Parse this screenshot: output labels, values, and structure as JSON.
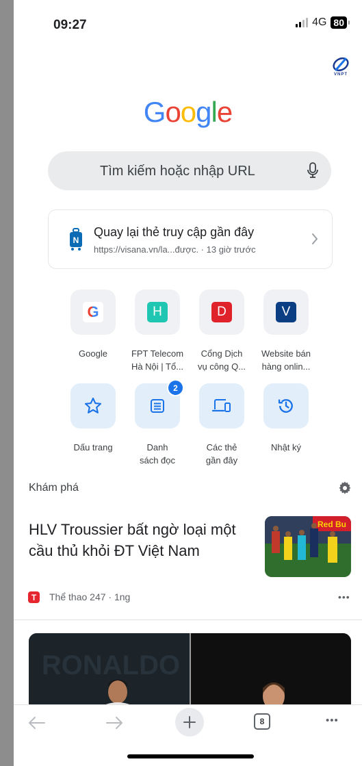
{
  "status_bar": {
    "time": "09:27",
    "network": "4G",
    "battery": "80"
  },
  "brand": {
    "operator_logo_text": "VNPT"
  },
  "logo": {
    "letters": [
      {
        "char": "G",
        "color": "#4285F4"
      },
      {
        "char": "o",
        "color": "#EA4335"
      },
      {
        "char": "o",
        "color": "#FBBC05"
      },
      {
        "char": "g",
        "color": "#4285F4"
      },
      {
        "char": "l",
        "color": "#34A853"
      },
      {
        "char": "e",
        "color": "#EA4335"
      }
    ]
  },
  "search": {
    "placeholder": "Tìm kiếm hoặc nhập URL"
  },
  "recent_tab": {
    "title": "Quay lại thẻ truy cập gần đây",
    "subtitle": "https://visana.vn/la...được. · 13 giờ trước"
  },
  "shortcuts": [
    {
      "letter": "G",
      "label_line1": "Google",
      "label_line2": "",
      "color": "#ffffff"
    },
    {
      "letter": "H",
      "label_line1": "FPT Telecom",
      "label_line2": "Hà Nội | Tổ...",
      "color": "#1fc7b2"
    },
    {
      "letter": "D",
      "label_line1": "Cổng Dịch",
      "label_line2": "vụ công Q...",
      "color": "#e0232b"
    },
    {
      "letter": "V",
      "label_line1": "Website bán",
      "label_line2": "hàng onlin...",
      "color": "#0b3e82"
    }
  ],
  "actions": [
    {
      "label_line1": "Dấu trang",
      "label_line2": "",
      "icon": "star-icon"
    },
    {
      "label_line1": "Danh",
      "label_line2": "sách đọc",
      "icon": "reading-list-icon",
      "badge": "2"
    },
    {
      "label_line1": "Các thẻ",
      "label_line2": "gần đây",
      "icon": "devices-icon"
    },
    {
      "label_line1": "Nhật ký",
      "label_line2": "",
      "icon": "history-icon"
    }
  ],
  "discover": {
    "title": "Khám phá",
    "articles": [
      {
        "title": "HLV Troussier bất ngờ loại một cầu thủ khỏi ĐT Việt Nam",
        "source": "Thể thao 247 · 1ng",
        "source_letter": "T",
        "more": "•••"
      }
    ]
  },
  "toolbar": {
    "tab_count": "8",
    "more": "•••"
  },
  "colors": {
    "accent": "#1a73e8",
    "action_tile_bg": "#e3eefb",
    "source_red": "#e5262f"
  }
}
